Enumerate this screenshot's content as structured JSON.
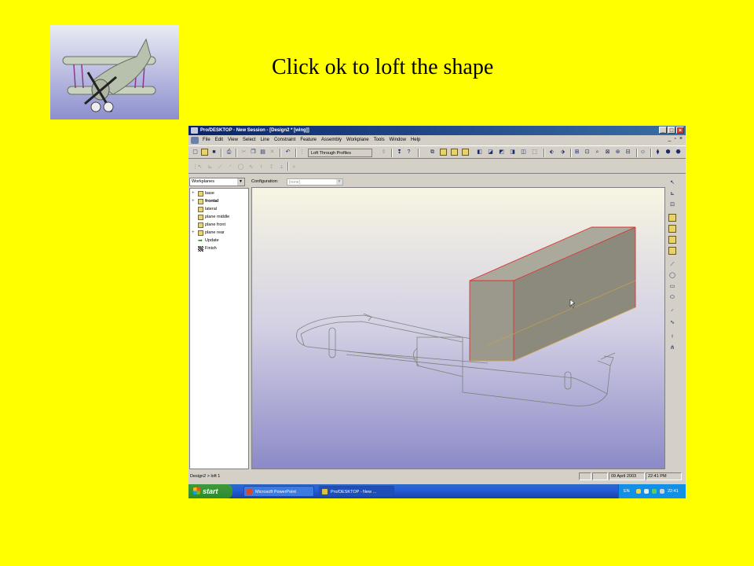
{
  "slide": {
    "title": "Click ok to loft the shape"
  },
  "window": {
    "title": "Pro/DESKTOP - New Session - [Design2 * [wing]]",
    "controls": [
      "_",
      "□",
      "×"
    ]
  },
  "menu": {
    "items": [
      "File",
      "Edit",
      "View",
      "Select",
      "Line",
      "Constraint",
      "Feature",
      "Assembly",
      "Workplane",
      "Tools",
      "Window",
      "Help"
    ],
    "mdi_controls": [
      "_",
      "▫",
      "×"
    ]
  },
  "toolbar": {
    "loft_field": "Loft Through Profiles"
  },
  "browser": {
    "dropdown_value": "Workplanes",
    "tree": [
      {
        "label": "base",
        "expander": "+",
        "icon": "workplane-icon",
        "bold": false
      },
      {
        "label": "frontal",
        "expander": "+",
        "icon": "workplane-icon",
        "bold": true
      },
      {
        "label": "lateral",
        "expander": "",
        "icon": "workplane-icon",
        "bold": false
      },
      {
        "label": "plane middle",
        "expander": "",
        "icon": "workplane-icon",
        "bold": false
      },
      {
        "label": "plane front",
        "expander": "",
        "icon": "workplane-icon",
        "bold": false
      },
      {
        "label": "plane rear",
        "expander": "+",
        "icon": "workplane-icon",
        "bold": false
      },
      {
        "label": "Update",
        "expander": "",
        "icon": "green-arrow-icon",
        "bold": false
      },
      {
        "label": "Finish",
        "expander": "",
        "icon": "checkered-flag-icon",
        "bold": false
      }
    ]
  },
  "configuration": {
    "label": "Configuration:",
    "value": "[none]"
  },
  "statusbar": {
    "left": "Design2 > loft 1",
    "date": "09 April 2003",
    "time": "22:41 PM"
  },
  "taskbar": {
    "start_label": "start",
    "tasks": [
      {
        "label": "Microsoft PowerPoint",
        "icon_color": "#d04a2f"
      },
      {
        "label": "Pro/DESKTOP - New ...",
        "icon_color": "#e0c040"
      }
    ],
    "language": "EN",
    "clock": "22:41"
  },
  "colors": {
    "slide_background": "#ffff00",
    "loft_edge": "#e03030",
    "loft_face": "#8c8a7c"
  }
}
